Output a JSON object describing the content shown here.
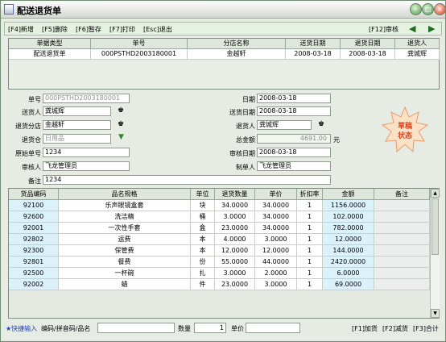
{
  "window": {
    "title": "配送退货单"
  },
  "toolbar": {
    "new": "[F4]新增",
    "delete": "[F5]删除",
    "hold": "[F6]暂存",
    "print": "[F7]打印",
    "exit": "[Esc]退出",
    "audit": "[F12]审核"
  },
  "top_grid": {
    "headers": [
      "单据类型",
      "单号",
      "分店名称",
      "送货日期",
      "退货日期",
      "退货人"
    ],
    "row": [
      "配送退货单",
      "000PSTHD2003180001",
      "金越轩",
      "2008-03-18",
      "2008-03-18",
      "龚城辉"
    ]
  },
  "form": {
    "doc_no_label": "单号",
    "doc_no": "000PSTHD2003180001",
    "date_label": "日期",
    "date": "2008-03-18",
    "sender_label": "送货人",
    "sender": "龚城辉",
    "ship_date_label": "送货日期",
    "ship_date": "2008-03-18",
    "branch_label": "退货分店",
    "branch": "金越轩",
    "returner_label": "退货人",
    "returner": "龚城辉",
    "warehouse_label": "退货仓",
    "warehouse": "日用品",
    "total_label": "总金额",
    "total": "4691.00",
    "total_unit": "元",
    "orig_no_label": "原始单号",
    "orig_no": "1234",
    "audit_date_label": "审核日期",
    "audit_date": "2008-03-18",
    "auditor_label": "审核人",
    "auditor": "飞龙管理员",
    "maker_label": "制单人",
    "maker": "飞龙管理员",
    "remark_label": "备注",
    "remark": "1234"
  },
  "stamp": {
    "line1": "草稿",
    "line2": "状态",
    "color": "#d9461e"
  },
  "detail": {
    "headers": [
      "货品编码",
      "品名规格",
      "单位",
      "退货数量",
      "单价",
      "折扣率",
      "金额",
      "备注"
    ],
    "rows": [
      [
        "92100",
        "乐声眼镜盒套",
        "块",
        "34.0000",
        "34.0000",
        "1",
        "1156.0000",
        ""
      ],
      [
        "92600",
        "洗洁精",
        "桶",
        "3.0000",
        "34.0000",
        "1",
        "102.0000",
        ""
      ],
      [
        "92001",
        "一次性手套",
        "盒",
        "23.0000",
        "34.0000",
        "1",
        "782.0000",
        ""
      ],
      [
        "92802",
        "运费",
        "本",
        "4.0000",
        "3.0000",
        "1",
        "12.0000",
        ""
      ],
      [
        "92300",
        "保管费",
        "本",
        "12.0000",
        "12.0000",
        "1",
        "144.0000",
        ""
      ],
      [
        "92801",
        "餐费",
        "份",
        "55.0000",
        "44.0000",
        "1",
        "2420.0000",
        ""
      ],
      [
        "92500",
        "一杯碗",
        "扎",
        "3.0000",
        "2.0000",
        "1",
        "6.0000",
        ""
      ],
      [
        "92002",
        "蜡",
        "件",
        "23.0000",
        "3.0000",
        "1",
        "69.0000",
        ""
      ]
    ]
  },
  "bottom": {
    "quick_label": "★快捷输入",
    "code_label": "编码/拼音码/品名",
    "qty_label": "数量",
    "qty": "1",
    "price_label": "单价",
    "add_label": "[F1]加货",
    "reduce_label": "[F2]减货",
    "total_label": "[F3]合计"
  }
}
